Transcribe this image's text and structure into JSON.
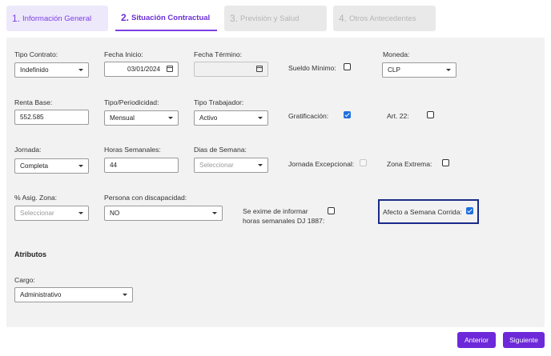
{
  "tabs": [
    {
      "num": "1.",
      "label": "Información General"
    },
    {
      "num": "2.",
      "label": "Situación Contractual"
    },
    {
      "num": "3.",
      "label": "Previsión y Salud"
    },
    {
      "num": "4.",
      "label": "Otros Antecedentes"
    }
  ],
  "form": {
    "tipo_contrato": {
      "label": "Tipo Contrato:",
      "value": "Indefinido"
    },
    "fecha_inicio": {
      "label": "Fecha Inicio:",
      "value": "03/01/2024"
    },
    "fecha_termino": {
      "label": "Fecha Término:",
      "value": ""
    },
    "sueldo_minimo": {
      "label": "Sueldo Mínimo:",
      "checked": false
    },
    "moneda": {
      "label": "Moneda:",
      "value": "CLP"
    },
    "renta_base": {
      "label": "Renta Base:",
      "value": "552.585"
    },
    "tipo_periodicidad": {
      "label": "Tipo/Periodicidad:",
      "value": "Mensual"
    },
    "tipo_trabajador": {
      "label": "Tipo Trabajador:",
      "value": "Activo"
    },
    "gratificacion": {
      "label": "Gratificación:",
      "checked": true
    },
    "art22": {
      "label": "Art. 22:",
      "checked": false
    },
    "jornada": {
      "label": "Jornada:",
      "value": "Completa"
    },
    "horas_semanales": {
      "label": "Horas Semanales:",
      "value": "44"
    },
    "dias_semana": {
      "label": "Dias de Semana:",
      "placeholder": "Seleccionar"
    },
    "jornada_excepcional": {
      "label": "Jornada Excepcional:",
      "checked": false
    },
    "zona_extrema": {
      "label": "Zona Extrema:",
      "checked": false
    },
    "asig_zona": {
      "label": "% Asig. Zona:",
      "placeholder": "Seleccionar"
    },
    "persona_discapacidad": {
      "label": "Persona con discapacidad:",
      "value": "NO"
    },
    "exime_dj": {
      "label_line1": "Se exime de informar",
      "label_line2": "horas semanales DJ 1887:",
      "checked": false
    },
    "semana_corrida": {
      "label": "Afecto a Semana Corrida:",
      "checked": true
    }
  },
  "atributos": {
    "title": "Atributos",
    "cargo": {
      "label": "Cargo:",
      "value": "Administrativo"
    }
  },
  "buttons": {
    "anterior": "Anterior",
    "siguiente": "Siguiente"
  },
  "colors": {
    "accent": "#6d28d9",
    "checkbox": "#1f6fde",
    "highlight": "#1a2a8a"
  }
}
